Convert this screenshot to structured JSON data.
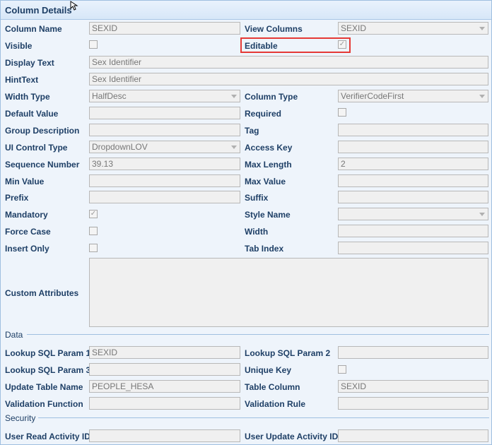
{
  "panel": {
    "title": "Column Details"
  },
  "left": [
    {
      "label": "Column Name"
    },
    {
      "label": "Visible"
    },
    {
      "label": "Display Text"
    },
    {
      "label": "HintText"
    },
    {
      "label": "Width Type"
    },
    {
      "label": "Default Value"
    },
    {
      "label": "Group Description"
    },
    {
      "label": "UI Control Type"
    },
    {
      "label": "Sequence Number"
    },
    {
      "label": "Min Value"
    },
    {
      "label": "Prefix"
    },
    {
      "label": "Mandatory"
    },
    {
      "label": "Force Case"
    },
    {
      "label": "Insert Only"
    },
    {
      "label": "Custom Attributes"
    }
  ],
  "right": [
    {
      "label": "View Columns"
    },
    {
      "label": "Editable"
    },
    {
      "label": "Column Type"
    },
    {
      "label": "Required"
    },
    {
      "label": "Tag"
    },
    {
      "label": "Access Key"
    },
    {
      "label": "Max Length"
    },
    {
      "label": "Max Value"
    },
    {
      "label": "Suffix"
    },
    {
      "label": "Style Name"
    },
    {
      "label": "Width"
    },
    {
      "label": "Tab Index"
    }
  ],
  "values": {
    "column_name": "SEXID",
    "view_columns": "SEXID",
    "display_text": "Sex Identifier",
    "hint_text": "Sex Identifier",
    "width_type": "HalfDesc",
    "column_type": "VerifierCodeFirst",
    "ui_control_type": "DropdownLOV",
    "sequence_number": "39.13",
    "max_length": "2",
    "lookup_sql_param_1": "SEXID",
    "update_table_name": "PEOPLE_HESA",
    "table_column": "SEXID"
  },
  "checks": {
    "visible": false,
    "editable": true,
    "required": false,
    "mandatory": true,
    "force_case": false,
    "insert_only": false,
    "unique_key": false
  },
  "data_section": {
    "title": "Data",
    "labels": {
      "lookup1": "Lookup SQL Param 1",
      "lookup2": "Lookup SQL Param 2",
      "lookup3": "Lookup SQL Param 3",
      "unique_key": "Unique Key",
      "update_table": "Update Table Name",
      "table_column": "Table Column",
      "validation_function": "Validation Function",
      "validation_rule": "Validation Rule"
    }
  },
  "security_section": {
    "title": "Security",
    "labels": {
      "read": "User Read Activity ID",
      "update": "User Update Activity ID"
    }
  },
  "check_glyph": "✓"
}
